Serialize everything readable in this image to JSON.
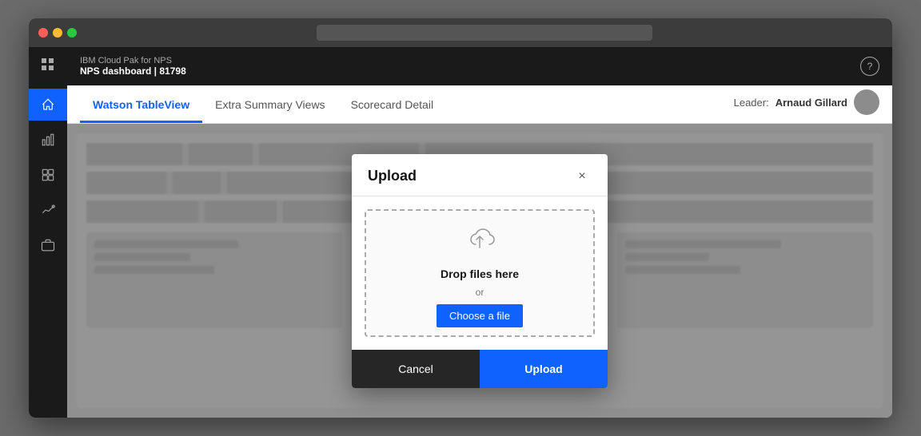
{
  "window": {
    "title_bar": {
      "url_placeholder": ""
    }
  },
  "app": {
    "name": "IBM Cloud Pak for NPS",
    "dashboard_title": "NPS dashboard | 81798"
  },
  "sidebar": {
    "items": [
      {
        "icon": "home-icon",
        "label": "Home",
        "active": true
      },
      {
        "icon": "chart-bar-icon",
        "label": "Charts",
        "active": false
      },
      {
        "icon": "dashboard-icon",
        "label": "Dashboard",
        "active": false
      },
      {
        "icon": "analytics-icon",
        "label": "Analytics",
        "active": false
      },
      {
        "icon": "briefcase-icon",
        "label": "Workspace",
        "active": false
      }
    ]
  },
  "tabs": {
    "items": [
      {
        "label": "Watson TableView",
        "active": true
      },
      {
        "label": "Extra Summary Views",
        "active": false
      },
      {
        "label": "Scorecard Detail",
        "active": false
      }
    ],
    "leader_label": "Leader:",
    "leader_name": "Arnaud Gillard"
  },
  "modal": {
    "title": "Upload",
    "close_label": "×",
    "drop_text": "Drop files here",
    "drop_or": "or",
    "choose_file_label": "Choose a file",
    "cancel_label": "Cancel",
    "upload_label": "Upload"
  }
}
